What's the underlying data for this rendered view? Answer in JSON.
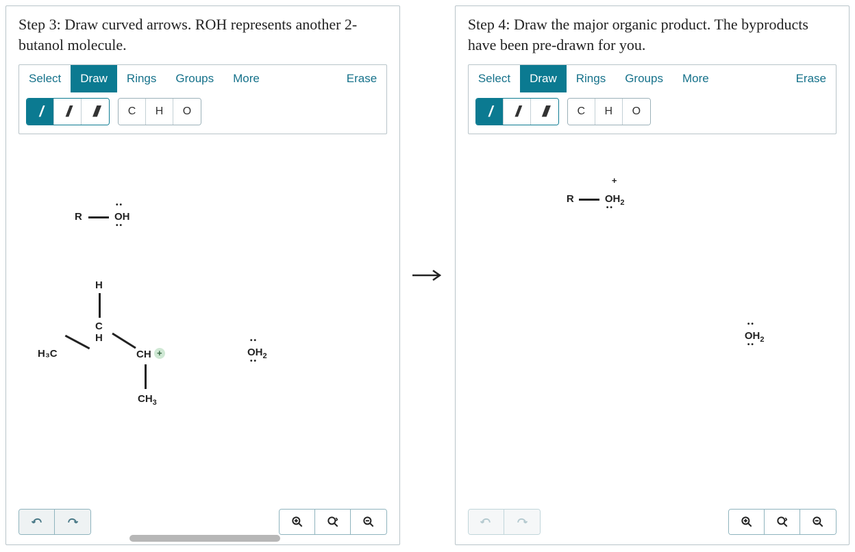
{
  "panels": [
    {
      "prompt": "Step 3: Draw curved arrows. ROH represents another 2-butanol molecule.",
      "tabs": [
        "Select",
        "Draw",
        "Rings",
        "Groups",
        "More"
      ],
      "active_tab": "Draw",
      "erase": "Erase",
      "elements": [
        "C",
        "H",
        "O"
      ],
      "bond_active": 0,
      "undo_disabled": false
    },
    {
      "prompt": "Step 4: Draw the major organic product. The byproducts have been pre-drawn for you.",
      "tabs": [
        "Select",
        "Draw",
        "Rings",
        "Groups",
        "More"
      ],
      "active_tab": "Draw",
      "erase": "Erase",
      "elements": [
        "C",
        "H",
        "O"
      ],
      "bond_active": 0,
      "undo_disabled": true
    }
  ],
  "molecules": {
    "left": {
      "roh_R": "R",
      "roh_OH": "OH",
      "H_top": "H",
      "C_center": "C",
      "H_center": "H",
      "H3C": "H₃C",
      "CH_plus": "CH",
      "CH3_bottom": "CH₃",
      "OH2": "OH₂"
    },
    "right": {
      "roh_R": "R",
      "roh_OH2": "OH₂",
      "OH2": "OH₂"
    }
  },
  "icons": {
    "undo": "undo-icon",
    "redo": "redo-icon",
    "zoom_in": "zoom-in-icon",
    "zoom_fit": "zoom-fit-icon",
    "zoom_out": "zoom-out-icon"
  }
}
